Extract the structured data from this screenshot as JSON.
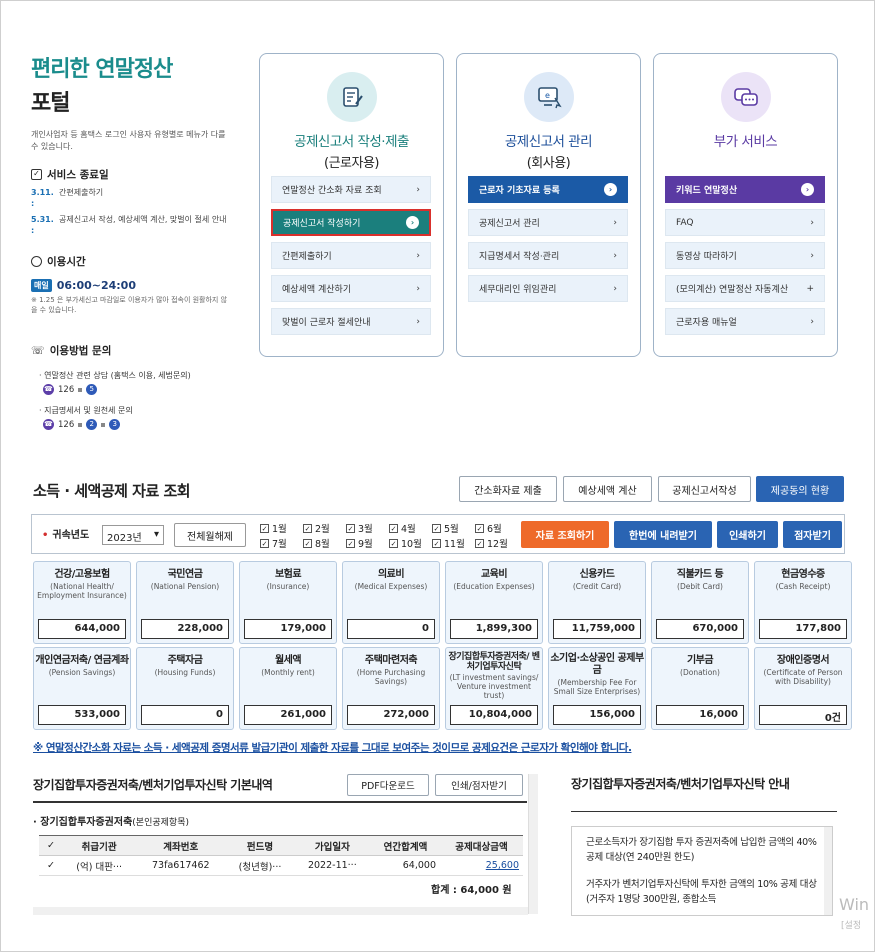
{
  "brand": {
    "line1": "편리한 연말정산",
    "line2": "포털"
  },
  "left_desc": "개인사업자 등 홈택스 로그인 사용자 유형별로 메뉴가 다를 수 있습니다.",
  "service_end": {
    "title": "서비스 종료일",
    "rows": [
      {
        "date": "3.11. :",
        "text": "간편제출하기"
      },
      {
        "date": "5.31. :",
        "text": "공제신고서 작성, 예상세액 계산, 맞벌이 절세 안내"
      }
    ]
  },
  "usage_time": {
    "title": "이용시간",
    "badge": "매일",
    "hours": "06:00~24:00",
    "note": "※ 1.25 은 부가세신고 마감일로 이용자가 많아 접속이 원활하지 않을 수 있습니다."
  },
  "inquiry": {
    "title": "이용방법 문의",
    "items": [
      {
        "text": "연말정산 관련 상담 (홈택스 이용, 세법문의)",
        "phone": "126",
        "nums": [
          "5"
        ]
      },
      {
        "text": "지급명세서 및 원천세 문의",
        "phone": "126",
        "nums": [
          "2",
          "3"
        ]
      }
    ]
  },
  "cards": [
    {
      "title": "공제신고서 작성·제출",
      "sub": "(근로자용)",
      "icon_bg": "#d9eef0",
      "items": [
        "연말정산 간소화 자료 조회",
        "공제신고서 작성하기",
        "간편제출하기",
        "예상세액 계산하기",
        "맞벌이 근로자 절세안내"
      ]
    },
    {
      "title": "공제신고서 관리",
      "sub": "(회사용)",
      "icon_bg": "#dde9f7",
      "items": [
        "근로자 기초자료 등록",
        "공제신고서 관리",
        "지급명세서 작성·관리",
        "세무대리인 위임관리"
      ]
    },
    {
      "title": "부가 서비스",
      "sub": "",
      "icon_bg": "#ebe3f7",
      "items": [
        "키워드 연말정산",
        "FAQ",
        "동영상 따라하기",
        "(모의계산) 연말정산 자동계산",
        "근로자용 매뉴얼"
      ]
    }
  ],
  "section": {
    "title": "소득 · 세액공제 자료 조회",
    "top_buttons": [
      "간소화자료 제출",
      "예상세액 계산",
      "공제신고서작성",
      "제공동의 현황"
    ]
  },
  "filter": {
    "label": "귀속년도",
    "year": "2023년",
    "deselect": "전체월해제",
    "months": [
      "1월",
      "2월",
      "3월",
      "4월",
      "5월",
      "6월",
      "7월",
      "8월",
      "9월",
      "10월",
      "11월",
      "12월"
    ],
    "actions": [
      "자료 조회하기",
      "한번에 내려받기",
      "인쇄하기",
      "점자받기"
    ]
  },
  "deductions_row1": [
    {
      "title": "건강/고용보험",
      "sub": "(National Health/ Employment Insurance)",
      "value": "644,000"
    },
    {
      "title": "국민연금",
      "sub": "(National Pension)",
      "value": "228,000"
    },
    {
      "title": "보험료",
      "sub": "(Insurance)",
      "value": "179,000"
    },
    {
      "title": "의료비",
      "sub": "(Medical Expenses)",
      "value": "0"
    },
    {
      "title": "교육비",
      "sub": "(Education Expenses)",
      "value": "1,899,300"
    },
    {
      "title": "신용카드",
      "sub": "(Credit Card)",
      "value": "11,759,000"
    },
    {
      "title": "직불카드 등",
      "sub": "(Debit Card)",
      "value": "670,000"
    },
    {
      "title": "현금영수증",
      "sub": "(Cash Receipt)",
      "value": "177,800"
    }
  ],
  "deductions_row2": [
    {
      "title": "개인연금저축/ 연금계좌",
      "sub": "(Pension Savings)",
      "value": "533,000"
    },
    {
      "title": "주택자금",
      "sub": "(Housing Funds)",
      "value": "0"
    },
    {
      "title": "월세액",
      "sub": "(Monthly rent)",
      "value": "261,000"
    },
    {
      "title": "주택마련저축",
      "sub": "(Home Purchasing Savings)",
      "value": "272,000"
    },
    {
      "title": "장기집합투자증권저축/ 벤처기업투자신탁",
      "sub": "(LT investment savings/ Venture investment trust)",
      "value": "10,804,000"
    },
    {
      "title": "소기업·소상공인 공제부금",
      "sub": "(Membership Fee For Small Size Enterprises)",
      "value": "156,000"
    },
    {
      "title": "기부금",
      "sub": "(Donation)",
      "value": "16,000"
    },
    {
      "title": "장애인증명서",
      "sub": "(Certificate of Person with Disability)",
      "value": "0건"
    }
  ],
  "notice": "※ 연말정산간소화 자료는 소득 · 세액공제 증명서류 발급기관이 제출한 자료를 그대로 보여주는 것이므로 공제요건은 근로자가 확인해야 합니다.",
  "bottom": {
    "title": "장기집합투자증권저축/벤처기업투자신탁 기본내역",
    "pdf_btn": "PDF다운로드",
    "print_btn": "인쇄/점자받기",
    "sub": "장기집합투자증권저축",
    "sub_small": "(본인공제항목)",
    "headers": [
      "취급기관",
      "계좌번호",
      "펀드명",
      "가입일자",
      "연간합계액",
      "공제대상금액"
    ],
    "row": [
      "(억) 대판···",
      "73fa617462",
      "(청년형)···",
      "2022-11···",
      "64,000",
      "25,600"
    ],
    "total": "합계 : 64,000 원"
  },
  "guide": {
    "title": "장기집합투자증권저축/벤처기업투자신탁 안내",
    "p1": "근로소득자가 장기집합 투자 증권저축에 납입한 금액의 40% 공제 대상(연 240만원 한도)",
    "p2": "거주자가 벤처기업투자신탁에 투자한 금액의 10% 공제 대상(거주자 1명당 300만원, 종합소득"
  },
  "watermark": {
    "line1": "Win",
    "line2": "[설정"
  }
}
